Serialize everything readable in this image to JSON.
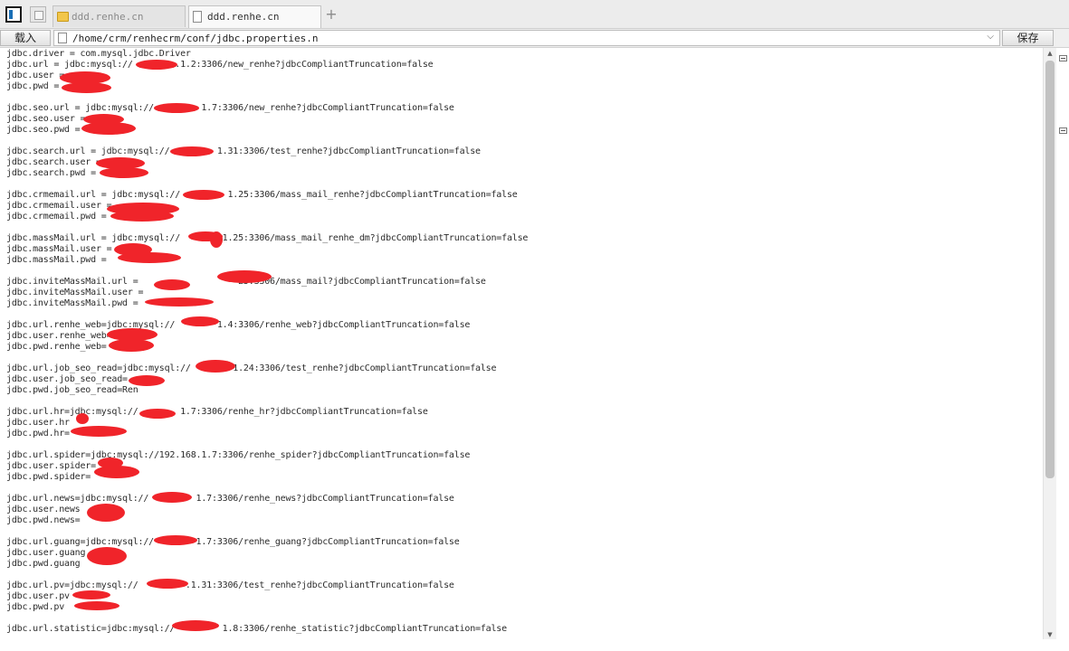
{
  "tabs": [
    {
      "label": "ddd.renhe.cn",
      "icon": "folder-icon",
      "active": false
    },
    {
      "label": "ddd.renhe.cn",
      "icon": "document-icon",
      "active": true
    }
  ],
  "new_tab_label": "+",
  "toolbar": {
    "load_label": "载入",
    "path_value": "/home/crm/renhecrm/conf/jdbc.properties.n",
    "save_label": "保存"
  },
  "lines": [
    "jdbc.driver = com.mysql.jdbc.Driver",
    "jdbc.url = jdbc:mysql://        .1.2:3306/new_renhe?jdbcCompliantTruncation=false",
    "jdbc.user =",
    "jdbc.pwd =",
    "",
    "jdbc.seo.url = jdbc:mysql://         1.7:3306/new_renhe?jdbcCompliantTruncation=false",
    "jdbc.seo.user =",
    "jdbc.seo.pwd =",
    "",
    "jdbc.search.url = jdbc:mysql://         1.31:3306/test_renhe?jdbcCompliantTruncation=false",
    "jdbc.search.user =",
    "jdbc.search.pwd =",
    "",
    "jdbc.crmemail.url = jdbc:mysql://         1.25:3306/mass_mail_renhe?jdbcCompliantTruncation=false",
    "jdbc.crmemail.user =",
    "jdbc.crmemail.pwd =",
    "",
    "jdbc.massMail.url = jdbc:mysql://        1.25:3306/mass_mail_renhe_dm?jdbcCompliantTruncation=false",
    "jdbc.massMail.user =",
    "jdbc.massMail.pwd =",
    "",
    "jdbc.inviteMassMail.url =                   25:3306/mass_mail?jdbcCompliantTruncation=false",
    "jdbc.inviteMassMail.user =",
    "jdbc.inviteMassMail.pwd =",
    "",
    "jdbc.url.renhe_web=jdbc:mysql://        1.4:3306/renhe_web?jdbcCompliantTruncation=false",
    "jdbc.user.renhe_web=",
    "jdbc.pwd.renhe_web=",
    "",
    "jdbc.url.job_seo_read=jdbc:mysql://        1.24:3306/test_renhe?jdbcCompliantTruncation=false",
    "jdbc.user.job_seo_read=",
    "jdbc.pwd.job_seo_read=Ren",
    "",
    "jdbc.url.hr=jdbc:mysql://        1.7:3306/renhe_hr?jdbcCompliantTruncation=false",
    "jdbc.user.hr",
    "jdbc.pwd.hr=",
    "",
    "jdbc.url.spider=jdbc:mysql://192.168.1.7:3306/renhe_spider?jdbcCompliantTruncation=false",
    "jdbc.user.spider=",
    "jdbc.pwd.spider=",
    "",
    "jdbc.url.news=jdbc:mysql://         1.7:3306/renhe_news?jdbcCompliantTruncation=false",
    "jdbc.user.news",
    "jdbc.pwd.news=",
    "",
    "jdbc.url.guang=jdbc:mysql://        1.7:3306/renhe_guang?jdbcCompliantTruncation=false",
    "jdbc.user.guang",
    "jdbc.pwd.guang",
    "",
    "jdbc.url.pv=jdbc:mysql://         .1.31:3306/test_renhe?jdbcCompliantTruncation=false",
    "jdbc.user.pv",
    "jdbc.pwd.pv",
    "",
    "jdbc.url.statistic=jdbc:mysql://         1.8:3306/renhe_statistic?jdbcCompliantTruncation=false"
  ],
  "redaction_color": "#f0242a"
}
